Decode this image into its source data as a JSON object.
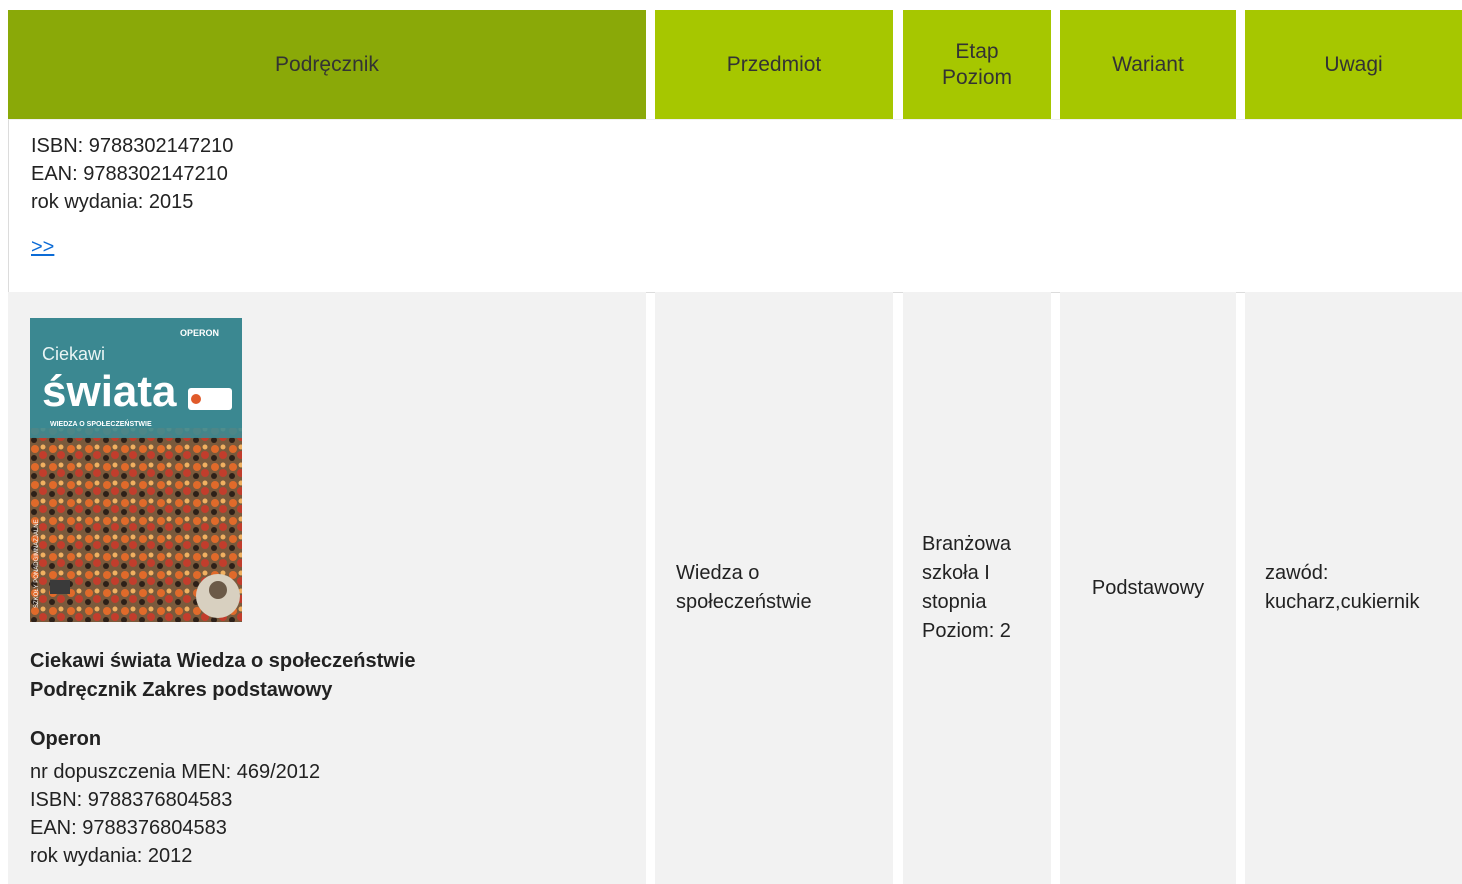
{
  "header": {
    "col1": "Podręcznik",
    "col2": "Przedmiot",
    "col3_line1": "Etap",
    "col3_line2": "Poziom",
    "col4": "Wariant",
    "col5": "Uwagi"
  },
  "row1": {
    "isbn": "ISBN: 9788302147210",
    "ean": "EAN: 9788302147210",
    "year": "rok wydania: 2015",
    "more_link": ">>"
  },
  "row2": {
    "cover": {
      "brand": "OPERON",
      "title_top": "Ciekawi",
      "title_big": "świata",
      "subtitle": "WIEDZA O SPOŁECZEŃSTWIE",
      "side_text": "SZKOŁY PONADGIMNAZJALNE"
    },
    "title_line1": "Ciekawi świata Wiedza o społeczeństwie",
    "title_line2": "Podręcznik Zakres podstawowy",
    "publisher": "Operon",
    "approval": "nr dopuszczenia MEN: 469/2012",
    "isbn": "ISBN: 9788376804583",
    "ean": "EAN: 9788376804583",
    "year": "rok wydania: 2012",
    "subject_line1": "Wiedza o",
    "subject_line2": "społeczeństwie",
    "stage_line1": "Branżowa",
    "stage_line2": "szkoła I",
    "stage_line3": "stopnia",
    "stage_line4": "Poziom: 2",
    "variant": "Podstawowy",
    "notes_line1": "zawód:",
    "notes_line2": "kucharz,cukiernik"
  },
  "colors": {
    "header_dark": "#8aa908",
    "header_lime": "#a6c700",
    "cell_bg": "#f2f2f2",
    "link": "#0b6bd6"
  }
}
